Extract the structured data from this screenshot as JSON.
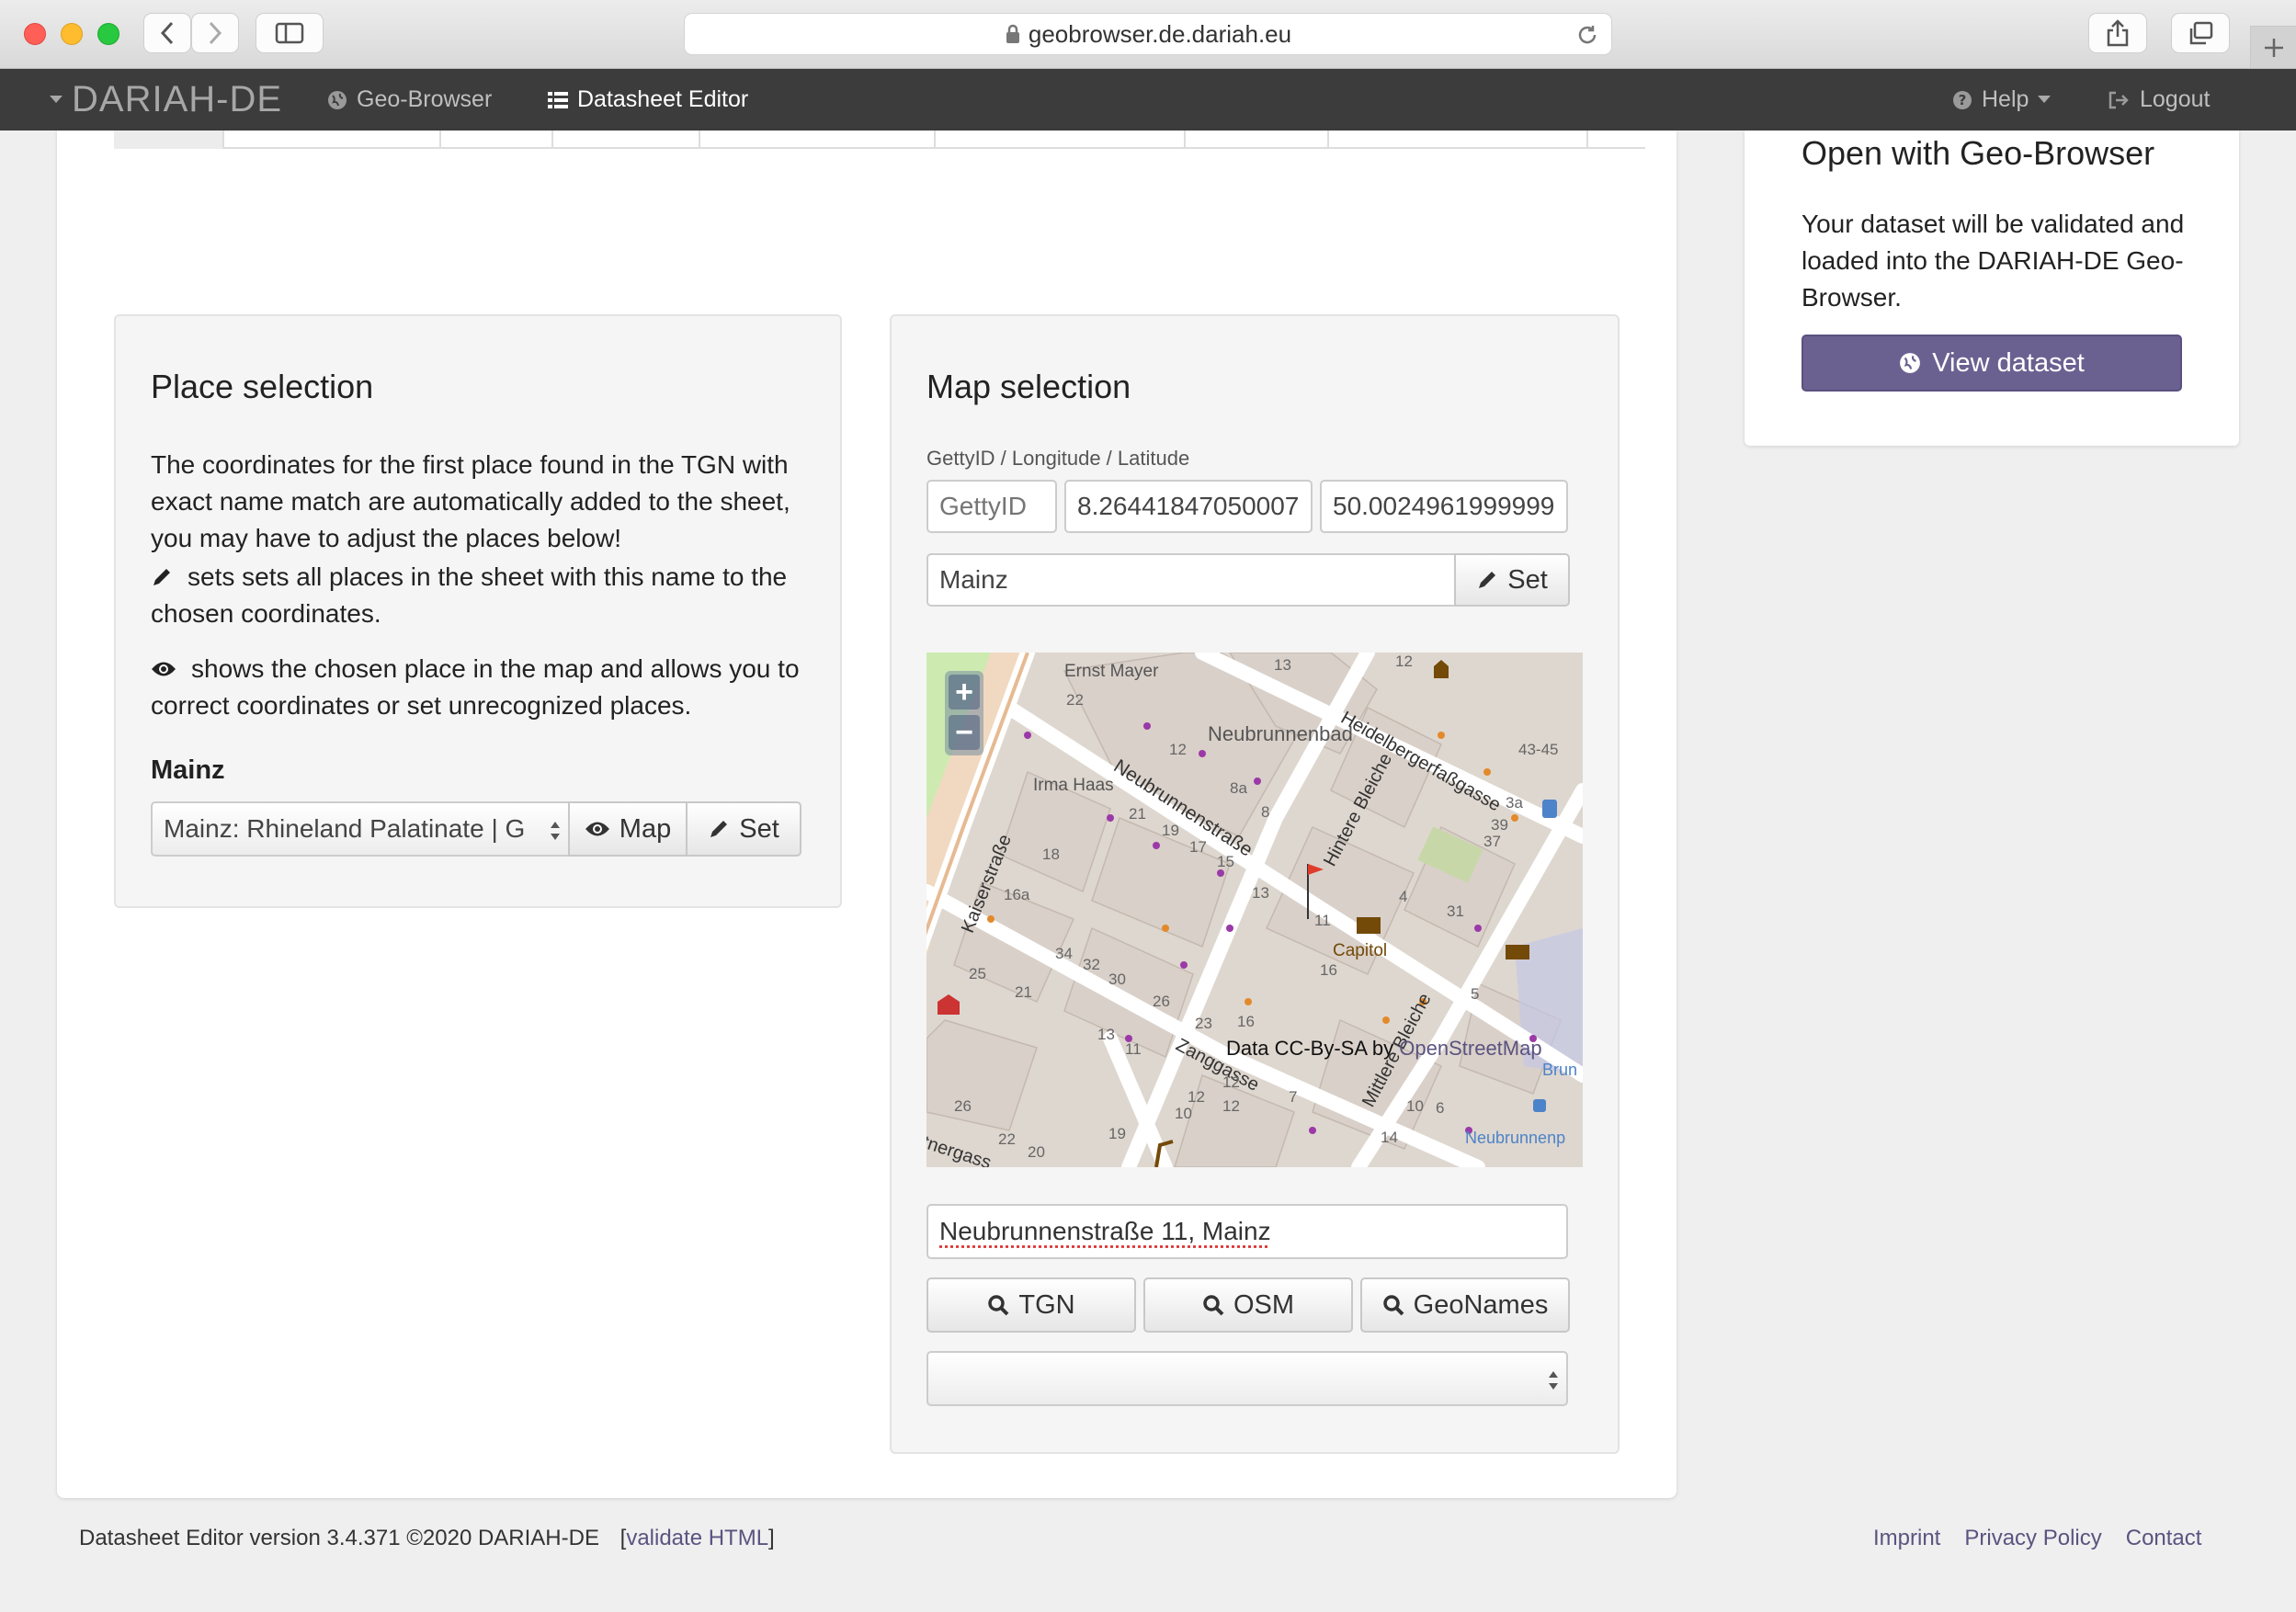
{
  "browser": {
    "url": "geobrowser.de.dariah.eu"
  },
  "nav": {
    "brand": "DARIAH-DE",
    "items": [
      {
        "label": "Geo-Browser",
        "icon": "globe-icon"
      },
      {
        "label": "Datasheet Editor",
        "icon": "list-icon"
      }
    ],
    "help": "Help",
    "logout": "Logout"
  },
  "place_selection": {
    "title": "Place selection",
    "intro": "The coordinates for the first place found in the TGN with exact name match are automatically added to the sheet, you may have to adjust the places below!",
    "pencil_hint": "sets sets all places in the sheet with this name to the chosen coordinates.",
    "eye_hint": "shows the chosen place in the map and allows you to correct coordinates or set unrecognized places.",
    "place_name": "Mainz",
    "place_select_value": "Mainz: Rhineland Palatinate | G",
    "map_button": "Map",
    "set_button": "Set"
  },
  "map_selection": {
    "title": "Map selection",
    "fields_label": "GettyID / Longitude / Latitude",
    "getty_placeholder": "GettyID",
    "longitude": "8.26441847050007",
    "latitude": "50.0024961999999",
    "place_value": "Mainz",
    "set_button": "Set",
    "map": {
      "zoom_in": "+",
      "zoom_out": "−",
      "attribution_prefix": "Data CC-By-SA by ",
      "attribution_link": "OpenStreetMap",
      "labels": {
        "ernst_mayer": "Ernst Mayer",
        "neubrunnenbad": "Neubrunnenbad",
        "heidelberger": "Heidelbergerfaßgasse",
        "irma_haas": "Irma Haas",
        "neubrunnenstrasse": "Neubrunnenstraße",
        "hintere_bleiche": "Hintere Bleiche",
        "kaiserstrasse": "Kaiserstraße",
        "capitol": "Capitol",
        "mittlere_bleiche": "Mittlere Bleiche",
        "zanggasse": "Zanggasse",
        "neubrunnen": "Neubrunnenp",
        "brun": "Brun",
        "tnergass": "tnergass",
        "n13": "13",
        "n12": "12",
        "n22": "22",
        "n12b": "12",
        "n8a": "8a",
        "n8": "8",
        "n21": "21",
        "n19": "19",
        "n17": "17",
        "n15": "15",
        "n18": "18",
        "n16a": "16a",
        "n13b": "13",
        "n11": "11",
        "n16": "16",
        "n34": "34",
        "n32": "32",
        "n30": "30",
        "n26": "26",
        "n23": "23",
        "n16b": "16",
        "n25": "25",
        "n21b": "21",
        "n13c": "13",
        "n11b": "11",
        "n3a": "3a",
        "n39": "39",
        "n37": "37",
        "n4": "4",
        "n31": "31",
        "n5": "5",
        "n4345": "43-45",
        "n12c": "12",
        "n12d": "12",
        "n10": "10",
        "n7": "7",
        "n14": "14",
        "n10b": "10",
        "n6": "6",
        "n26b": "26",
        "n22b": "22",
        "n20": "20",
        "n19b": "19",
        "n12e": "12"
      }
    },
    "address_value": "Neubrunnenstraße 11, Mainz",
    "search_buttons": [
      "TGN",
      "OSM",
      "GeoNames"
    ],
    "result_select_value": ""
  },
  "sidebar": {
    "title": "Open with Geo-Browser",
    "text": "Your dataset will be validated and loaded into the DARIAH-DE Geo-Browser.",
    "view_button": "View dataset",
    "accent": "#6b6191"
  },
  "footer": {
    "version": "Datasheet Editor version 3.4.371 ©2020 DARIAH-DE",
    "validate_open": "[",
    "validate": "validate HTML",
    "validate_close": "]",
    "links": [
      "Imprint",
      "Privacy Policy",
      "Contact"
    ]
  }
}
